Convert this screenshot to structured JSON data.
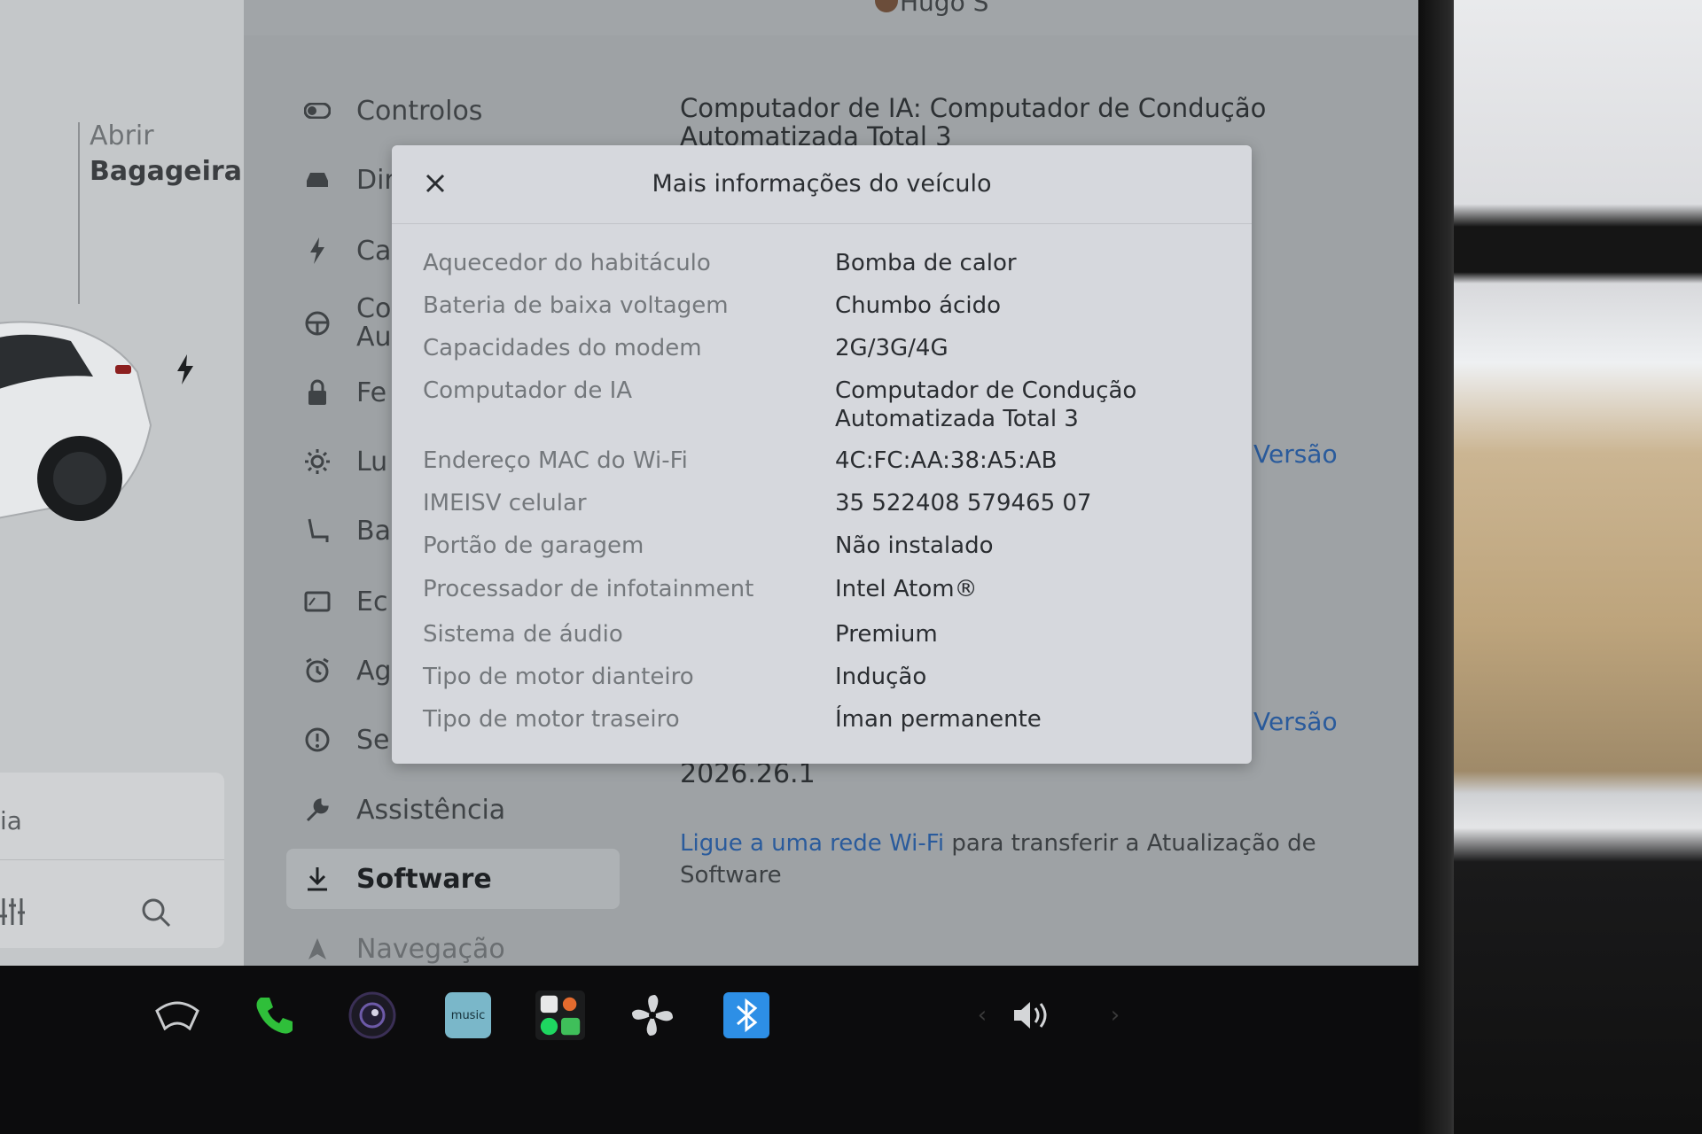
{
  "header": {
    "user_name": "Hugo S"
  },
  "left_panel": {
    "trunk_open": "Abrir",
    "trunk_label": "Bagageira",
    "media_text": "ia"
  },
  "menu": {
    "items": [
      {
        "label": "Controlos",
        "icon": "toggle-icon"
      },
      {
        "label": "Dir",
        "icon": "car-icon"
      },
      {
        "label": "Ca",
        "icon": "bolt-icon"
      },
      {
        "label": "Co",
        "label2": "Au",
        "icon": "steering-wheel-icon"
      },
      {
        "label": "Fe",
        "icon": "lock-icon"
      },
      {
        "label": "Lu",
        "icon": "sun-icon"
      },
      {
        "label": "Ba",
        "icon": "seat-icon"
      },
      {
        "label": "Ec",
        "icon": "screen-icon"
      },
      {
        "label": "Ag",
        "icon": "alarm-clock-icon"
      },
      {
        "label": "Se",
        "icon": "info-circle-icon"
      },
      {
        "label": "Assistência",
        "icon": "wrench-icon"
      },
      {
        "label": "Software",
        "icon": "download-icon",
        "active": true
      },
      {
        "label": "Navegação",
        "icon": "navigation-icon"
      }
    ]
  },
  "software": {
    "ai_computer_line1": "Computador de IA: Computador de Condução",
    "ai_computer_line2": "Automatizada Total 3",
    "versao_link_1": "Versão",
    "versao_link_2": "Versão",
    "version_number": "2026.26.1",
    "wifi_link": "Ligue a uma rede Wi-Fi",
    "wifi_text_1": " para transferir a Atualização de",
    "wifi_text_2": "Software"
  },
  "modal": {
    "title": "Mais informações do veículo",
    "rows": [
      {
        "label": "Aquecedor do habitáculo",
        "value": "Bomba de calor"
      },
      {
        "label": "Bateria de baixa voltagem",
        "value": "Chumbo ácido"
      },
      {
        "label": "Capacidades do modem",
        "value": "2G/3G/4G"
      },
      {
        "label": "Computador de IA",
        "value": "Computador de Condução",
        "value2": "Automatizada Total 3"
      },
      {
        "label": "Endereço MAC do Wi-Fi",
        "value": "4C:FC:AA:38:A5:AB"
      },
      {
        "label": "IMEISV celular",
        "value": "35 522408 579465 07"
      },
      {
        "label": "Portão de garagem",
        "value": "Não instalado"
      },
      {
        "label": "Processador de infotainment",
        "value": "Intel Atom®"
      },
      {
        "label": "Sistema de áudio",
        "value": "Premium"
      },
      {
        "label": "Tipo de motor dianteiro",
        "value": "Indução"
      },
      {
        "label": "Tipo de motor traseiro",
        "value": "Íman permanente"
      }
    ]
  },
  "taskbar": {
    "music_label": "music",
    "icons": [
      "wiper-icon",
      "phone-icon",
      "camera-icon",
      "amazon-music-icon",
      "apps-icon",
      "fan-icon",
      "bluetooth-icon",
      "volume-icon"
    ]
  },
  "colors": {
    "link": "#2a5b9c",
    "phone_green": "#2fbf3a",
    "bluetooth_blue": "#2d8fe6",
    "amazon_music": "#7ab7c9"
  }
}
